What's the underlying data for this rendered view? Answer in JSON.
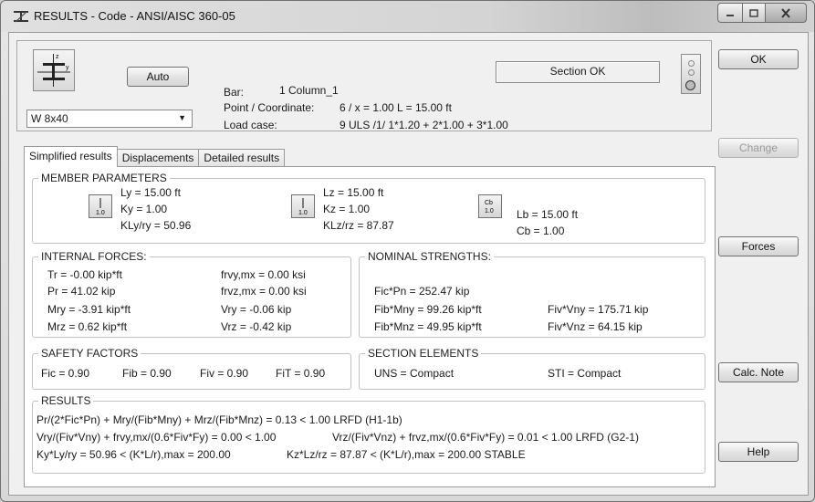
{
  "window": {
    "title": "RESULTS - Code - ANSI/AISC 360-05"
  },
  "section": {
    "auto_label": "Auto",
    "profile_value": "W 8x40",
    "icon_axis_z": "z",
    "icon_axis_y": "y"
  },
  "info": {
    "bar_label": "Bar:",
    "bar_value": "1 Column_1",
    "point_label": "Point / Coordinate:",
    "point_value": "6 / x = 1.00 L = 15.00 ft",
    "load_label": "Load case:",
    "load_value": "9 ULS /1/  1*1.20 + 2*1.00 + 3*1.00",
    "status": "Section OK"
  },
  "tabs": [
    "Simplified results",
    "Displacements",
    "Detailed results"
  ],
  "member_parameters": {
    "title": "MEMBER PARAMETERS",
    "col1": [
      "Ly = 15.00 ft",
      "Ky = 1.00",
      "KLy/ry = 50.96"
    ],
    "col2": [
      "Lz = 15.00 ft",
      "Kz = 1.00",
      "KLz/rz = 87.87"
    ],
    "col3": [
      "Lb = 15.00 ft",
      "Cb = 1.00"
    ],
    "icon1": "1.0",
    "icon2": "1.0",
    "icon3_top": "Cb",
    "icon3_bottom": "1.0"
  },
  "internal_forces": {
    "title": "INTERNAL FORCES:",
    "left": [
      "Tr = -0.00 kip*ft",
      "Pr = 41.02 kip",
      "Mry = -3.91 kip*ft",
      "Mrz = 0.62 kip*ft"
    ],
    "right": [
      "frvy,mx = 0.00 ksi",
      "frvz,mx = 0.00 ksi",
      "Vry = -0.06 kip",
      "Vrz = -0.42 kip"
    ]
  },
  "nominal_strengths": {
    "title": "NOMINAL STRENGTHS:",
    "left": [
      "Fic*Pn = 252.47 kip",
      "Fib*Mny = 99.26 kip*ft",
      "Fib*Mnz = 49.95 kip*ft"
    ],
    "right": [
      "Fiv*Vny = 175.71 kip",
      "Fiv*Vnz = 64.15 kip"
    ]
  },
  "safety_factors": {
    "title": "SAFETY FACTORS",
    "items": [
      "Fic = 0.90",
      "Fib = 0.90",
      "Fiv = 0.90",
      "FiT = 0.90"
    ]
  },
  "section_elements": {
    "title": "SECTION ELEMENTS",
    "uns": "UNS = Compact",
    "sti": "STI = Compact"
  },
  "results": {
    "title": "RESULTS",
    "line1": "Pr/(2*Fic*Pn) + Mry/(Fib*Mny) + Mrz/(Fib*Mnz) = 0.13 < 1.00   LRFD (H1-1b)",
    "line2a": "Vry/(Fiv*Vny) + frvy,mx/(0.6*Fiv*Fy) = 0.00 < 1.00",
    "line2b": "Vrz/(Fiv*Vnz) + frvz,mx/(0.6*Fiv*Fy) = 0.01 < 1.00   LRFD (G2-1)",
    "line3a": "Ky*Ly/ry = 50.96 < (K*L/r),max = 200.00",
    "line3b": "Kz*Lz/rz = 87.87 < (K*L/r),max = 200.00    STABLE"
  },
  "buttons": {
    "ok": "OK",
    "change": "Change",
    "forces": "Forces",
    "calc_note": "Calc. Note",
    "help": "Help"
  }
}
